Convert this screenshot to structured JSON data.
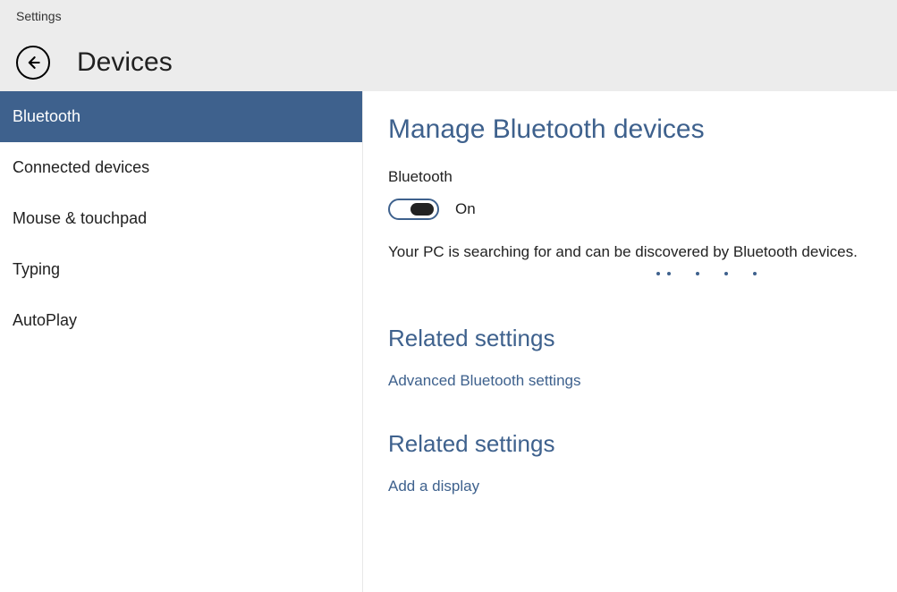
{
  "app": {
    "title": "Settings"
  },
  "header": {
    "page_title": "Devices"
  },
  "sidebar": {
    "items": [
      {
        "label": "Bluetooth",
        "active": true
      },
      {
        "label": "Connected devices",
        "active": false
      },
      {
        "label": "Mouse & touchpad",
        "active": false
      },
      {
        "label": "Typing",
        "active": false
      },
      {
        "label": "AutoPlay",
        "active": false
      }
    ]
  },
  "main": {
    "heading": "Manage Bluetooth devices",
    "toggle_label": "Bluetooth",
    "toggle_state": "On",
    "status_text": "Your PC is searching for and can be discovered by Bluetooth devices.",
    "sections": [
      {
        "heading": "Related settings",
        "link": "Advanced Bluetooth settings"
      },
      {
        "heading": "Related settings",
        "link": "Add a display"
      }
    ]
  }
}
